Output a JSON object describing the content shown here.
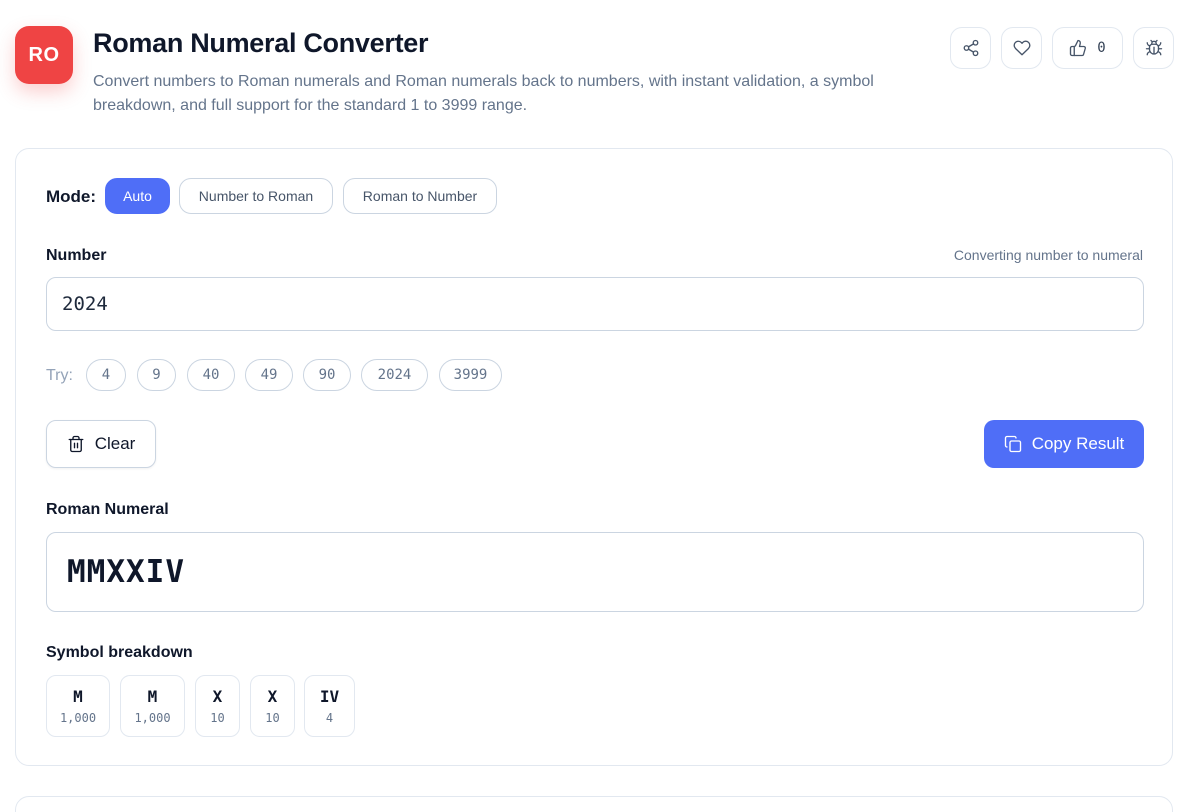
{
  "header": {
    "logo_text": "RO",
    "title": "Roman Numeral Converter",
    "description": "Convert numbers to Roman numerals and Roman numerals back to numbers, with instant validation, a symbol breakdown, and full support for the standard 1 to 3999 range.",
    "like_count": "0",
    "actions": [
      "share-icon",
      "heart-icon",
      "thumbs-up-icon",
      "bug-icon"
    ]
  },
  "mode": {
    "label": "Mode:",
    "options": [
      "Auto",
      "Number to Roman",
      "Roman to Number"
    ],
    "selected": "Auto"
  },
  "input": {
    "label": "Number",
    "hint": "Converting number to numeral",
    "value": "2024"
  },
  "try": {
    "label": "Try:",
    "examples": [
      "4",
      "9",
      "40",
      "49",
      "90",
      "2024",
      "3999"
    ]
  },
  "buttons": {
    "clear": "Clear",
    "copy": "Copy Result"
  },
  "result": {
    "label": "Roman Numeral",
    "value": "MMXXIV"
  },
  "breakdown": {
    "label": "Symbol breakdown",
    "items": [
      {
        "symbol": "M",
        "value": "1,000"
      },
      {
        "symbol": "M",
        "value": "1,000"
      },
      {
        "symbol": "X",
        "value": "10"
      },
      {
        "symbol": "X",
        "value": "10"
      },
      {
        "symbol": "IV",
        "value": "4"
      }
    ]
  },
  "colors": {
    "accent": "#4f6ef7",
    "logo": "#ef4444"
  }
}
